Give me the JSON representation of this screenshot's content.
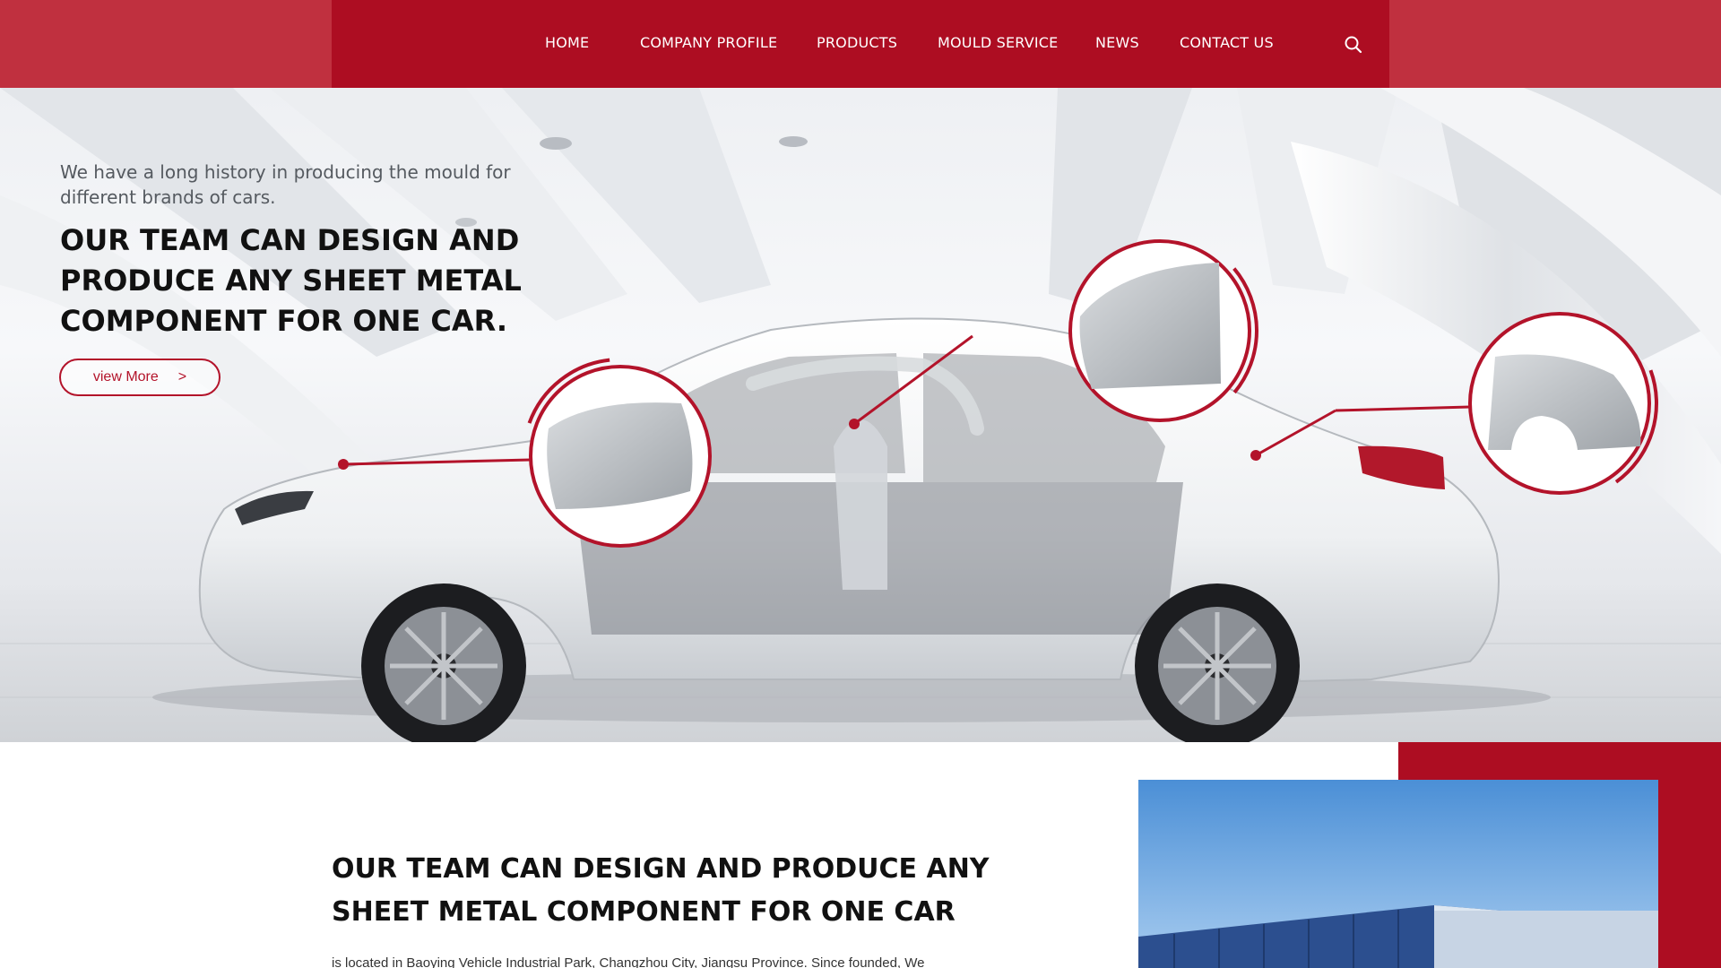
{
  "nav": {
    "items": [
      "HOME",
      "COMPANY PROFILE",
      "PRODUCTS",
      "MOULD SERVICE",
      "NEWS",
      "CONTACT US"
    ],
    "search_icon": "search-icon"
  },
  "hero": {
    "subtitle": "We have a long history in producing the mould for different brands of cars.",
    "title": "OUR TEAM CAN DESIGN AND PRODUCE ANY SHEET METAL COMPONENT FOR ONE CAR.",
    "button_label": "view More",
    "button_arrow": ">",
    "callouts": [
      "hood-part",
      "door-part",
      "rear-quarter-panel-part"
    ]
  },
  "about": {
    "title": "OUR TEAM CAN DESIGN AND PRODUCE ANY SHEET METAL COMPONENT FOR ONE CAR",
    "text": "is located in Baoying Vehicle Industrial Park, Changzhou City, Jiangsu Province. Since founded, We"
  },
  "colors": {
    "brand_red": "#ad0d22",
    "header_side_red": "#c0303f",
    "accent_red": "#b3132a"
  }
}
